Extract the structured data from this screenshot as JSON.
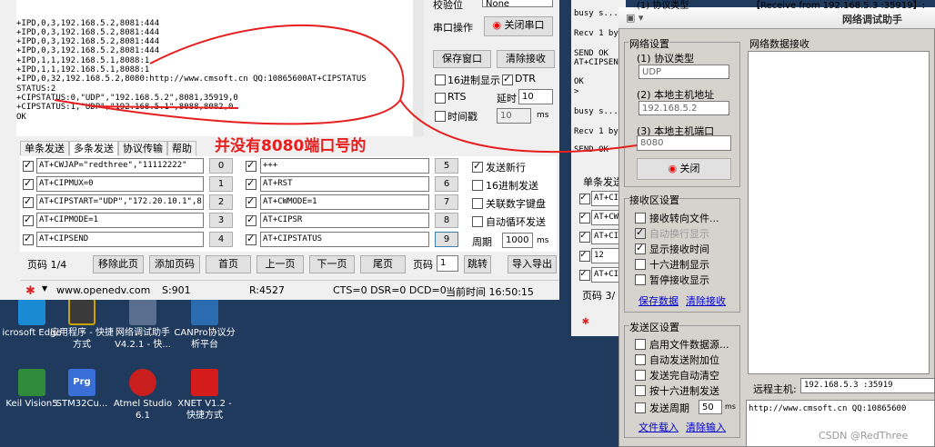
{
  "receive_text": [
    "+IPD,0,3,192.168.5.2,8081:444",
    "+IPD,0,3,192.168.5.2,8081:444",
    "+IPD,0,3,192.168.5.2,8081:444",
    "+IPD,0,3,192.168.5.2,8081:444",
    "+IPD,1,1,192.168.5.1,8088:1",
    "+IPD,1,1,192.168.5.1,8088:1",
    "+IPD,0,32,192.168.5.2,8080:http://www.cmsoft.cn QQ:10865600AT+CIPSTATUS",
    "STATUS:2",
    "+CIPSTATUS:0,\"UDP\",\"192.168.5.2\",8081,35919,0",
    "+CIPSTATUS:1,\"UDP\",\"192.168.5.1\",8088,8082,0",
    "",
    "OK"
  ],
  "serial": {
    "baud_label": "校验位",
    "baud_value": "None",
    "port_op_label": "串口操作",
    "close_port": "关闭串口",
    "save_window": "保存窗口",
    "clear_recv": "清除接收",
    "hex_display": "16进制显示",
    "dtr": "DTR",
    "rts": "RTS",
    "delay_label": "延时",
    "delay_value": "10",
    "timestamp": "时间戳",
    "ts_value": "10",
    "ms": "ms"
  },
  "tabs": [
    "单条发送",
    "多条发送",
    "协议传输",
    "帮助"
  ],
  "commands_left": [
    "AT+CWJAP=\"redthree\",\"11112222\"",
    "AT+CIPMUX=0",
    "AT+CIPSTART=\"UDP\",\"172.20.10.1\",8(",
    "AT+CIPMODE=1",
    "AT+CIPSEND"
  ],
  "nums_left": [
    "0",
    "1",
    "2",
    "3",
    "4"
  ],
  "commands_right": [
    "+++",
    "AT+RST",
    "AT+CWMODE=1",
    "AT+CIPSR",
    "AT+CIPSTATUS"
  ],
  "nums_right": [
    "5",
    "6",
    "7",
    "8",
    "9"
  ],
  "options": {
    "newline": "发送新行",
    "hex_send": "16进制发送",
    "assoc_kb": "关联数字键盘",
    "auto_loop": "自动循环发送",
    "period": "周期",
    "period_value": "1000",
    "ms": "ms"
  },
  "pagebar": {
    "page": "页码 1/4",
    "remove": "移除此页",
    "add": "添加页码",
    "first": "首页",
    "prev": "上一页",
    "next": "下一页",
    "last": "尾页",
    "page_label": "页码",
    "page_value": "1",
    "jump": "跳转",
    "import": "导入导出"
  },
  "status": {
    "url": "www.openedv.com",
    "s": "S:901",
    "r": "R:4527",
    "lines": "CTS=0 DSR=0 DCD=0",
    "time": "当前时间 16:50:15"
  },
  "mid_lines": [
    "busy s...",
    "Recv 1 by",
    "SEND OK",
    "AT+CIPSEN",
    "OK",
    ">",
    "busy s...",
    "Recv 1 by",
    "SEND OK"
  ],
  "mid_cmds": [
    "AT+CI",
    "AT+CW",
    "AT+CI",
    "12",
    "AT+CI"
  ],
  "mid_tab": "单条发送",
  "mid_page": "页码 3/",
  "net": {
    "title": "网络调试助手",
    "recv_title": "网络数据接收",
    "top_info": "【Receive from 192.168.5.3 :35919】:",
    "top_prot": "(1) 协议类型",
    "settings": "网络设置",
    "protocol_label": "(1) 协议类型",
    "protocol": "UDP",
    "host_label": "(2) 本地主机地址",
    "host": "192.168.5.2",
    "port_label": "(3) 本地主机端口",
    "port": "8080",
    "close": "关闭",
    "recv_settings": "接收区设置",
    "recv_to_file": "接收转向文件...",
    "auto_wrap": "自动换行显示",
    "show_time": "显示接收时间",
    "hex_show": "十六进制显示",
    "pause": "暂停接收显示",
    "save": "保存数据",
    "clear": "清除接收",
    "send_settings": "发送区设置",
    "file_src": "启用文件数据源...",
    "auto_add": "自动发送附加位",
    "clear_after": "发送完自动清空",
    "hex_send": "按十六进制发送",
    "period": "发送周期",
    "period_value": "50",
    "ms": "ms",
    "load_file": "文件载入",
    "clear_input": "清除输入",
    "remote_label": "远程主机:",
    "remote": "192.168.5.3 :35919",
    "send_text": "http://www.cmsoft.cn QQ:10865600"
  },
  "desktop": [
    {
      "label": "icrosoft Edge"
    },
    {
      "label": "应用程序 - 快捷方式"
    },
    {
      "label": "网络调试助手 V4.2.1 - 快..."
    },
    {
      "label": "CANPro协议分析平台"
    },
    {
      "label": "Keil Vision5"
    },
    {
      "label": "STM32Cu..."
    },
    {
      "label": "Atmel Studio 6.1"
    },
    {
      "label": "XNET V1.2 - 快捷方式"
    }
  ],
  "annotation": "并没有8080端口号的",
  "watermark": "CSDN @RedThree"
}
